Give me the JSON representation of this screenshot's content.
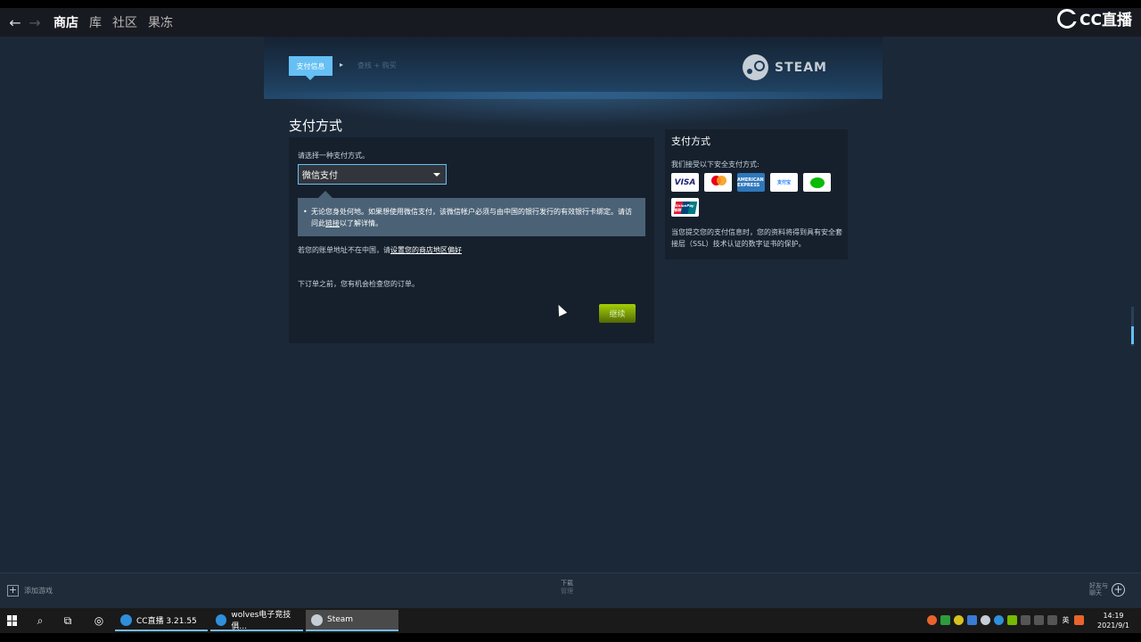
{
  "watermark": {
    "text": "CC直播"
  },
  "nav": {
    "back": "←",
    "forward": "→",
    "items": [
      {
        "label": "商店",
        "active": true
      },
      {
        "label": "库"
      },
      {
        "label": "社区"
      },
      {
        "label": "果冻"
      }
    ]
  },
  "checkout": {
    "steps": {
      "current": "支付信息",
      "separator": "▸",
      "next": "查核 + 购买"
    },
    "brand": "STEAM",
    "title": "支付方式",
    "choose_label": "请选择一种支付方式。",
    "selected_method": "微信支付",
    "notice": {
      "bullet": "•",
      "text_before": "无论您身处何地。如果想使用微信支付，该微信帐户必须与由中国的银行发行的有效银行卡绑定。请访问此",
      "link": "链接",
      "text_after": "以了解详情。"
    },
    "billing_note": {
      "text": "若您的账单地址不在中国，请",
      "link": "设置您的商店地区偏好"
    },
    "review_note": "下订单之前，您有机会检查您的订单。",
    "continue_label": "继续"
  },
  "side": {
    "title": "支付方式",
    "accept_label": "我们接受以下安全支付方式:",
    "cards": [
      {
        "name": "visa",
        "label": "VISA"
      },
      {
        "name": "mastercard",
        "label": ""
      },
      {
        "name": "amex",
        "label": "AMERICAN EXPRESS"
      },
      {
        "name": "alipay",
        "label": "支付宝"
      },
      {
        "name": "wechat",
        "label": ""
      },
      {
        "name": "unionpay",
        "label": "UnionPay 银联"
      }
    ],
    "ssl_note": "当您提交您的支付信息时，您的资料将得到具有安全套接层（SSL）技术认证的数字证书的保护。"
  },
  "bottom_bar": {
    "add_game": "添加游戏",
    "downloads": "下载",
    "downloads_sub": "管理",
    "friends_line1": "好友与",
    "friends_line2": "聊天"
  },
  "taskbar": {
    "apps": [
      {
        "label": "CC直播 3.21.55"
      },
      {
        "label": "wolves电子竞技俱..."
      },
      {
        "label": "Steam"
      }
    ],
    "tray_lang": "英",
    "time": "14:19",
    "date": "2021/9/1"
  }
}
